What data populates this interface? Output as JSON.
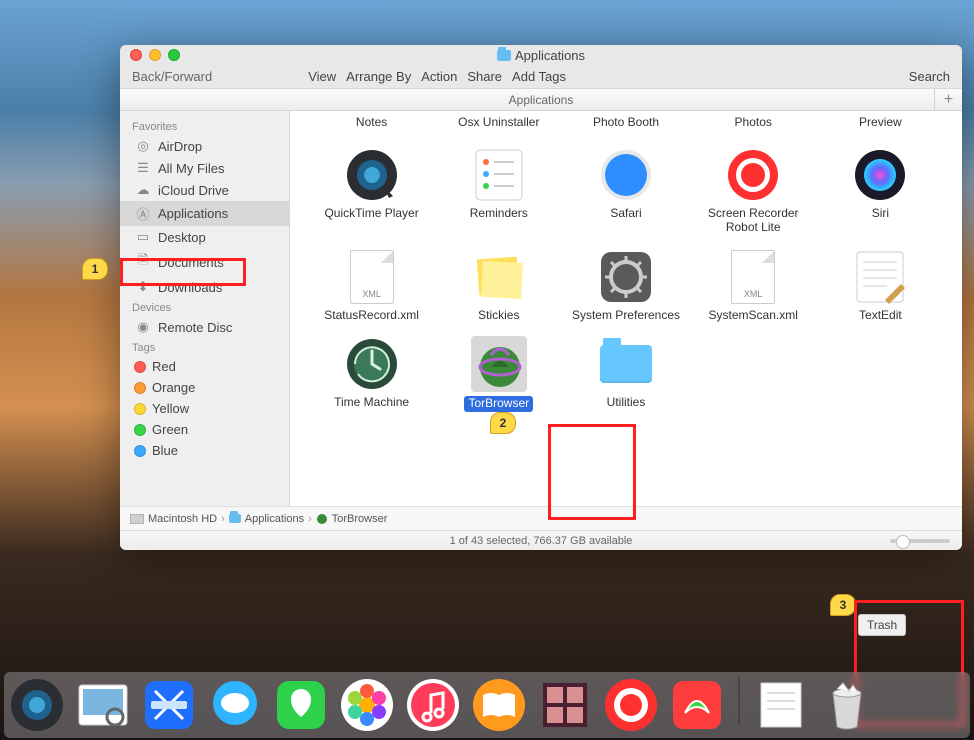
{
  "window": {
    "title": "Applications",
    "toolbar": {
      "back_forward": "Back/Forward",
      "menus": [
        "View",
        "Arrange By",
        "Action",
        "Share",
        "Add Tags"
      ],
      "search": "Search"
    },
    "subheader": "Applications"
  },
  "sidebar": {
    "sections": [
      {
        "title": "Favorites",
        "items": [
          {
            "icon": "airdrop-icon",
            "label": "AirDrop"
          },
          {
            "icon": "all-my-files-icon",
            "label": "All My Files"
          },
          {
            "icon": "icloud-drive-icon",
            "label": "iCloud Drive"
          },
          {
            "icon": "applications-icon",
            "label": "Applications",
            "active": true
          },
          {
            "icon": "desktop-icon",
            "label": "Desktop"
          },
          {
            "icon": "documents-icon",
            "label": "Documents"
          },
          {
            "icon": "downloads-icon",
            "label": "Downloads"
          }
        ]
      },
      {
        "title": "Devices",
        "items": [
          {
            "icon": "remote-disc-icon",
            "label": "Remote Disc"
          }
        ]
      },
      {
        "title": "Tags",
        "items": [
          {
            "color": "#ff5c55",
            "label": "Red"
          },
          {
            "color": "#ff9d33",
            "label": "Orange"
          },
          {
            "color": "#ffd633",
            "label": "Yellow"
          },
          {
            "color": "#3bd24a",
            "label": "Green"
          },
          {
            "color": "#3fa8ff",
            "label": "Blue"
          }
        ]
      }
    ]
  },
  "header_labels": [
    "Notes",
    "Osx Uninstaller",
    "Photo Booth",
    "Photos",
    "Preview"
  ],
  "apps_row1": [
    {
      "name": "QuickTime Player",
      "icon": "quicktime"
    },
    {
      "name": "Reminders",
      "icon": "reminders"
    },
    {
      "name": "Safari",
      "icon": "safari"
    },
    {
      "name": "Screen Recorder Robot Lite",
      "icon": "screenrec"
    },
    {
      "name": "Siri",
      "icon": "siri"
    }
  ],
  "apps_row2": [
    {
      "name": "StatusRecord.xml",
      "icon": "xml"
    },
    {
      "name": "Stickies",
      "icon": "stickies"
    },
    {
      "name": "System Preferences",
      "icon": "sysprefs"
    },
    {
      "name": "SystemScan.xml",
      "icon": "xml"
    },
    {
      "name": "TextEdit",
      "icon": "textedit"
    }
  ],
  "apps_row3": [
    {
      "name": "Time Machine",
      "icon": "timemachine"
    },
    {
      "name": "TorBrowser",
      "icon": "tor",
      "selected": true
    },
    {
      "name": "Utilities",
      "icon": "folder"
    }
  ],
  "pathbar": [
    "Macintosh HD",
    "Applications",
    "TorBrowser"
  ],
  "statusbar": "1 of 43 selected, 766.37 GB available",
  "dock": {
    "items": [
      {
        "name": "quicktime",
        "label": "QuickTime"
      },
      {
        "name": "preview",
        "label": "Preview"
      },
      {
        "name": "xcode",
        "label": "Xcode"
      },
      {
        "name": "messages",
        "label": "Messages"
      },
      {
        "name": "facetime",
        "label": "FaceTime"
      },
      {
        "name": "photos",
        "label": "Photos"
      },
      {
        "name": "itunes",
        "label": "iTunes"
      },
      {
        "name": "ibooks",
        "label": "iBooks"
      },
      {
        "name": "photobooth",
        "label": "Photo Booth"
      },
      {
        "name": "recorder",
        "label": "Screen Recorder"
      },
      {
        "name": "uninstaller",
        "label": "Osx Uninstaller"
      }
    ],
    "right": [
      {
        "name": "document-stack",
        "label": "Documents"
      },
      {
        "name": "trash",
        "label": "Trash"
      }
    ]
  },
  "callouts": {
    "c1": "1",
    "c2": "2",
    "c3": "3",
    "trash_tooltip": "Trash"
  }
}
